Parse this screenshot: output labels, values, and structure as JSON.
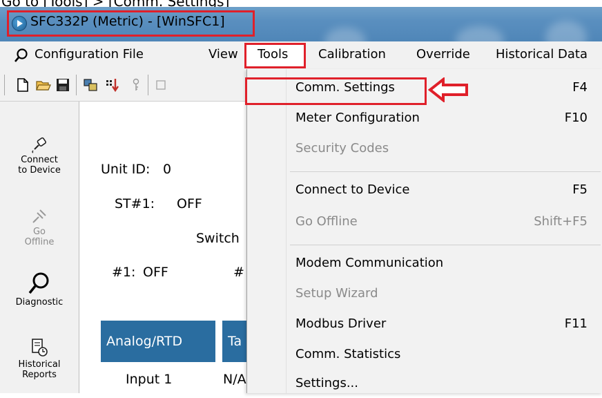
{
  "caption": "Go to [Tools] > [Comm. Settings]",
  "window": {
    "title": "SFC332P (Metric) - [WinSFC1]"
  },
  "menubar": {
    "items": [
      "Configuration File",
      "View",
      "Tools",
      "Calibration",
      "Override",
      "Historical Data"
    ]
  },
  "sidebar": {
    "items": [
      {
        "label_line1": "Connect",
        "label_line2": "to Device",
        "icon": "connect-plug-icon"
      },
      {
        "label_line1": "Go",
        "label_line2": "Offline",
        "icon": "go-offline-icon"
      },
      {
        "label_line1": "Diagnostic",
        "label_line2": "",
        "icon": "magnifier-icon"
      },
      {
        "label_line1": "Historical",
        "label_line2": "Reports",
        "icon": "historical-reports-icon"
      }
    ]
  },
  "main": {
    "unit_id_label": "Unit ID:",
    "unit_id_value": "0",
    "st1_label": "ST#1:",
    "st1_value": "OFF",
    "switch_label": "Switch",
    "sw1_label": "#1:",
    "sw1_value": "OFF",
    "sw2_label": "#",
    "tab_analog": "Analog/RTD",
    "tab_second": "Ta",
    "input1_label": "Input 1",
    "input1_value": "N/A"
  },
  "tools_menu": {
    "items": [
      {
        "label": "Comm. Settings",
        "shortcut": "F4",
        "enabled": true
      },
      {
        "label": "Meter Configuration",
        "shortcut": "F10",
        "enabled": true
      },
      {
        "label": "Security Codes",
        "shortcut": "",
        "enabled": false
      },
      {
        "label": "Connect to Device",
        "shortcut": "F5",
        "enabled": true
      },
      {
        "label": "Go Offline",
        "shortcut": "Shift+F5",
        "enabled": false
      },
      {
        "label": "Modem Communication",
        "shortcut": "",
        "enabled": true
      },
      {
        "label": "Setup Wizard",
        "shortcut": "",
        "enabled": false
      },
      {
        "label": "Modbus Driver",
        "shortcut": "F11",
        "enabled": true
      },
      {
        "label": "Comm. Statistics",
        "shortcut": "",
        "enabled": true
      },
      {
        "label": "Settings...",
        "shortcut": "",
        "enabled": true
      }
    ]
  },
  "colors": {
    "highlight_red": "#e0202a",
    "tab_blue": "#2a6da0",
    "titlebar_blue": "#5a8fbf"
  }
}
